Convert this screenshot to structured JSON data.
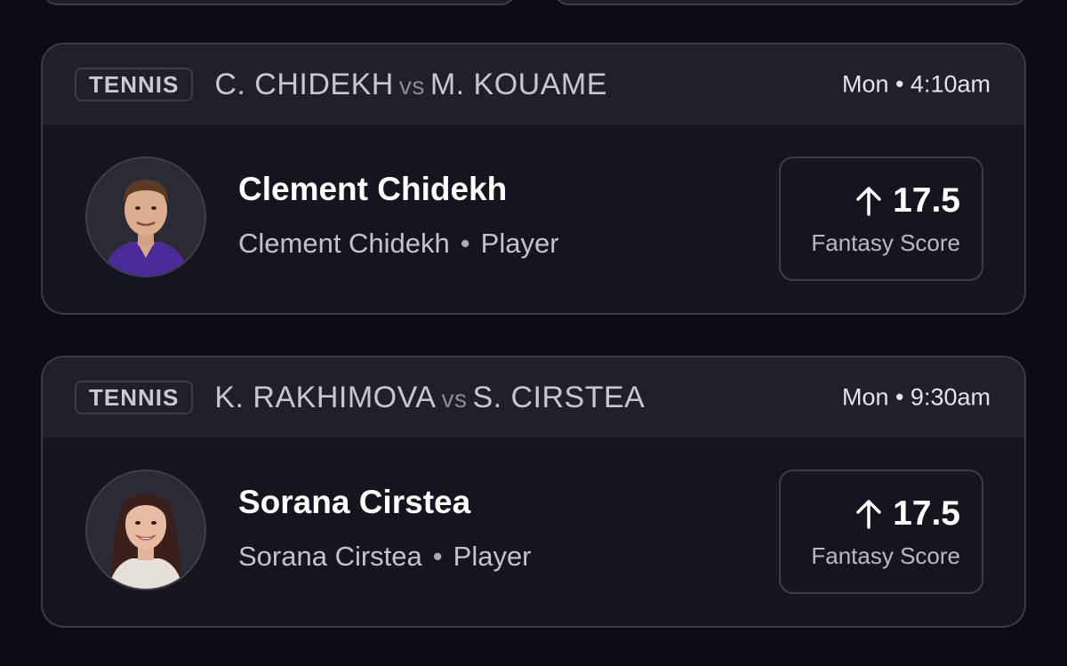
{
  "colors": {
    "background": "#0b0c14",
    "card": "#14151f",
    "card_header": "#1f2029",
    "border": "#3a3b47"
  },
  "cards": [
    {
      "sport": "TENNIS",
      "team_a": "C. CHIDEKH",
      "vs": "vs",
      "team_b": "M. KOUAME",
      "time": "Mon • 4:10am",
      "player_name": "Clement Chidekh",
      "player_sub_name": "Clement Chidekh",
      "dot": "•",
      "position": "Player",
      "direction_icon": "arrow-up-icon",
      "line": "17.5",
      "stat": "Fantasy Score"
    },
    {
      "sport": "TENNIS",
      "team_a": "K. RAKHIMOVA",
      "vs": "vs",
      "team_b": "S. CIRSTEA",
      "time": "Mon • 9:30am",
      "player_name": "Sorana Cirstea",
      "player_sub_name": "Sorana Cirstea",
      "dot": "•",
      "position": "Player",
      "direction_icon": "arrow-up-icon",
      "line": "17.5",
      "stat": "Fantasy Score"
    }
  ]
}
